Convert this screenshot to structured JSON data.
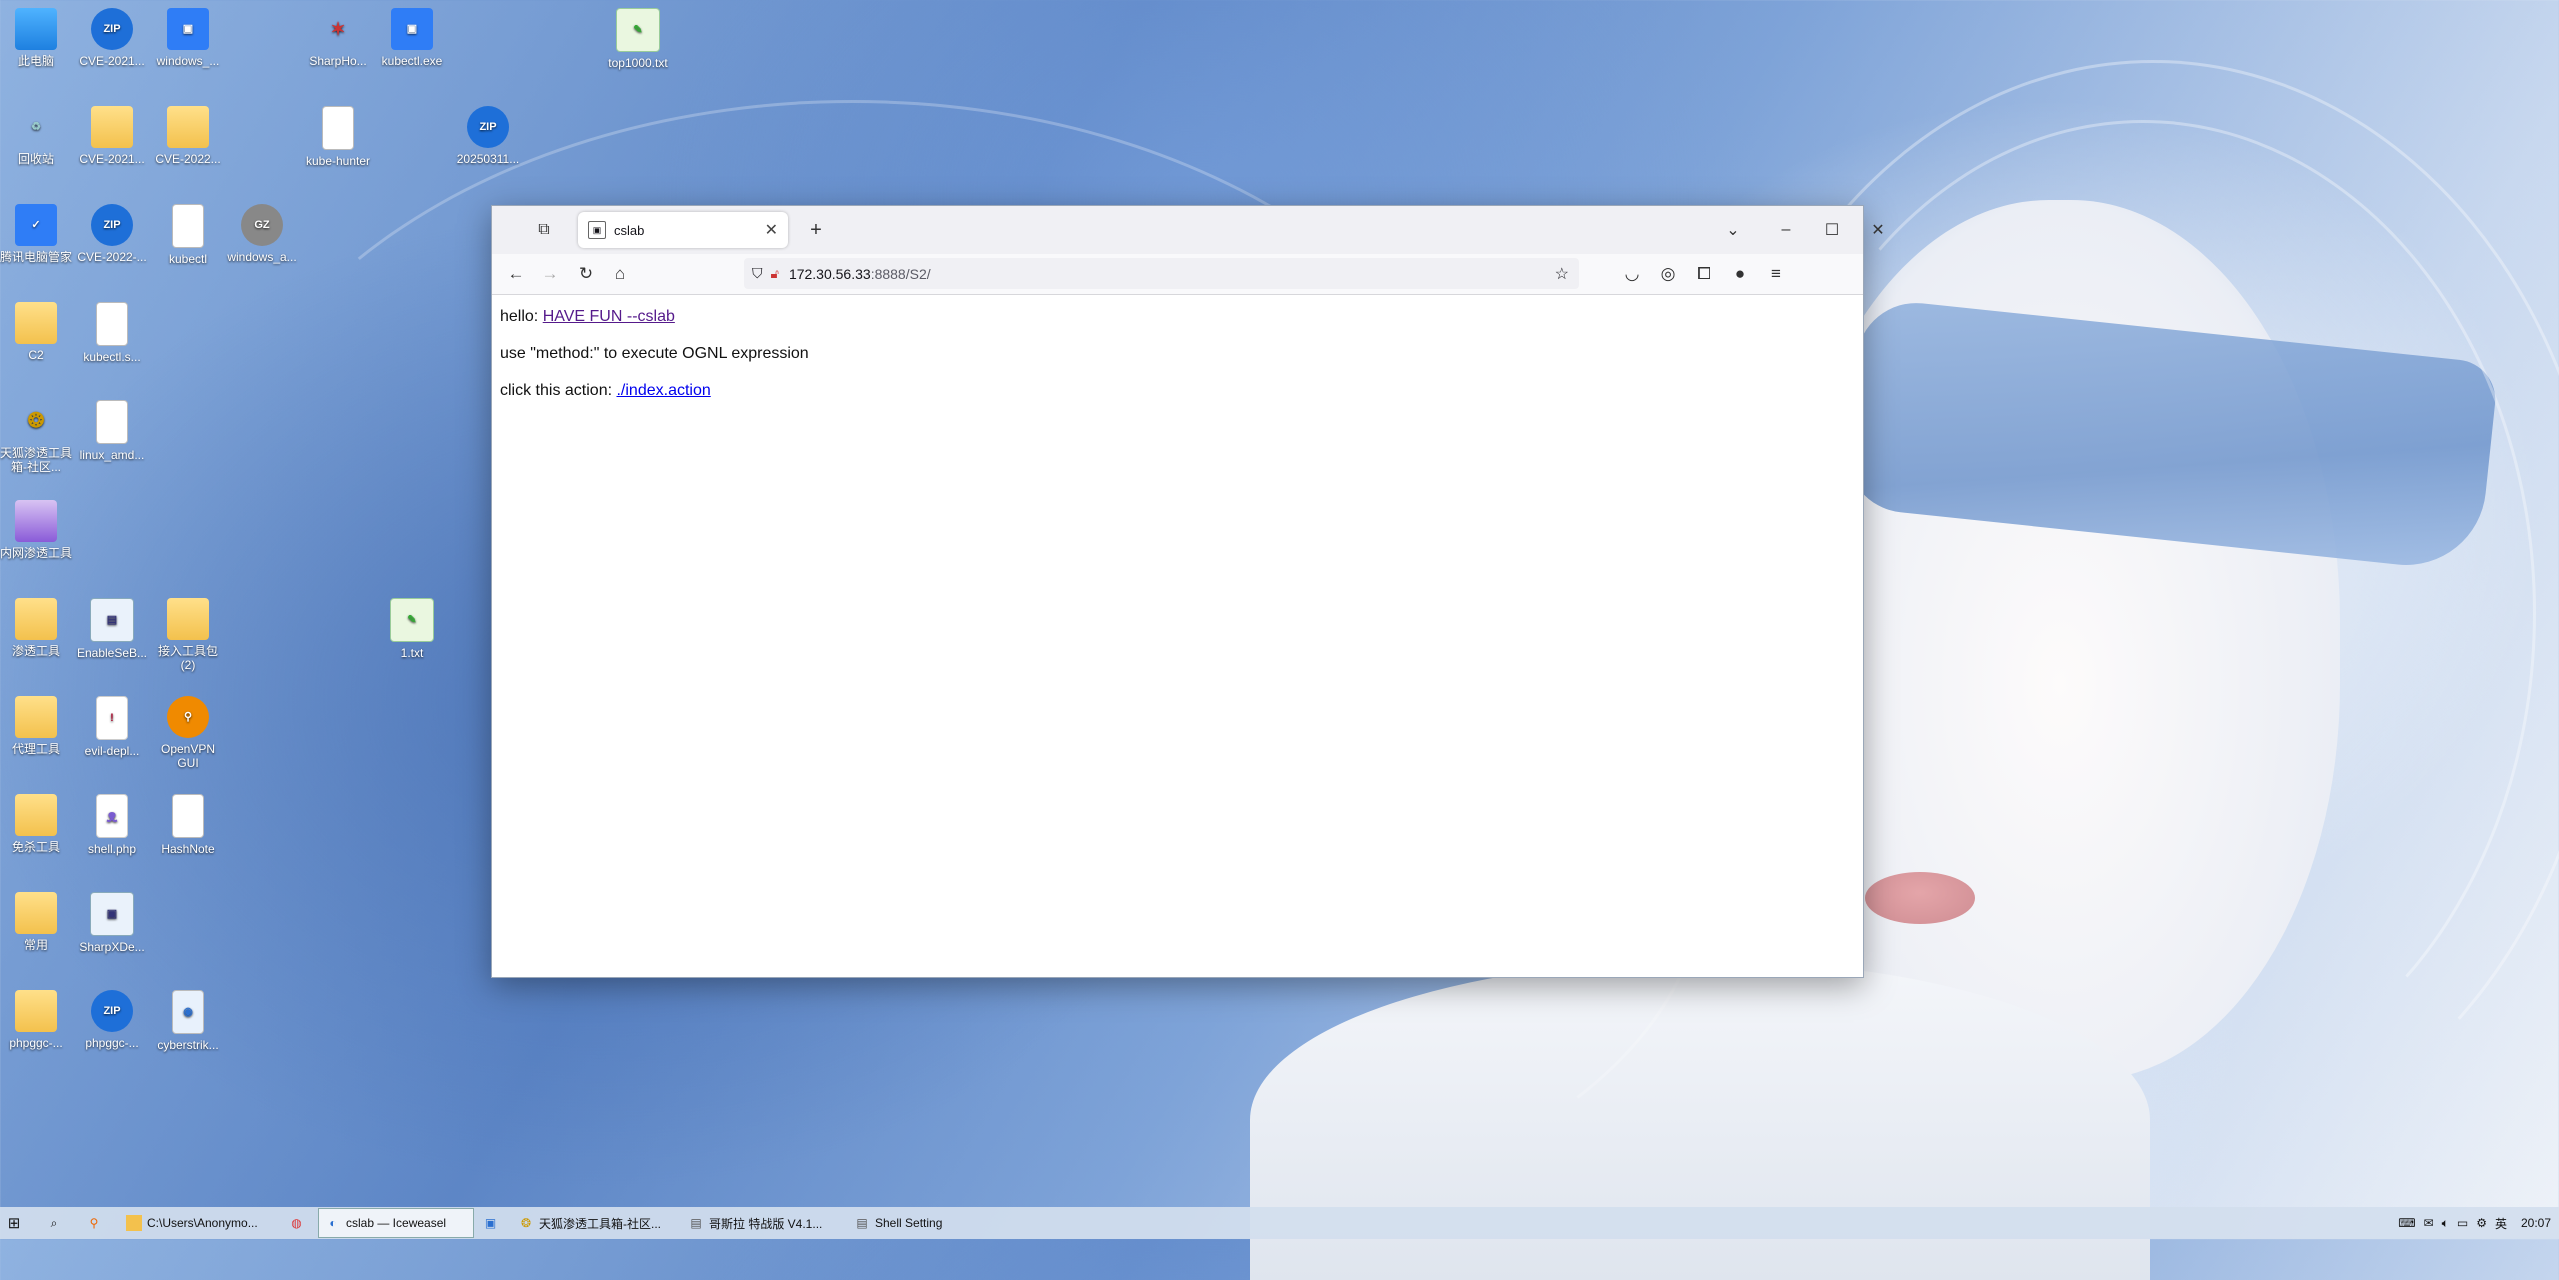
{
  "desktop": {
    "icons": [
      {
        "label": "此电脑",
        "icon": "computer-icon"
      },
      {
        "label": "CVE-2021...",
        "icon": "zip-icon"
      },
      {
        "label": "windows_...",
        "icon": "app-icon"
      },
      {
        "label": "SharpHo...",
        "icon": "app-icon"
      },
      {
        "label": "kubectl.exe",
        "icon": "app-icon"
      },
      {
        "label": "top1000.txt",
        "icon": "text-file-icon"
      },
      {
        "label": "回收站",
        "icon": "recycle-bin-icon"
      },
      {
        "label": "CVE-2021...",
        "icon": "folder-icon"
      },
      {
        "label": "CVE-2022...",
        "icon": "folder-icon"
      },
      {
        "label": "kube-hunter",
        "icon": "file-icon"
      },
      {
        "label": "20250311...",
        "icon": "zip-icon"
      },
      {
        "label": "腾讯电脑管家",
        "icon": "shield-app-icon"
      },
      {
        "label": "CVE-2022-...",
        "icon": "zip-icon"
      },
      {
        "label": "kubectl",
        "icon": "file-icon"
      },
      {
        "label": "windows_a...",
        "icon": "gz-icon"
      },
      {
        "label": "C2",
        "icon": "folder-icon"
      },
      {
        "label": "kubectl.s...",
        "icon": "file-icon"
      },
      {
        "label": "天狐渗透工具箱-社区...",
        "icon": "app-icon"
      },
      {
        "label": "linux_amd...",
        "icon": "file-icon"
      },
      {
        "label": "内网渗透工具",
        "icon": "folder-icon"
      },
      {
        "label": "渗透工具",
        "icon": "folder-icon"
      },
      {
        "label": "EnableSeB...",
        "icon": "image-file-icon"
      },
      {
        "label": "接入工具包(2)",
        "icon": "folder-icon"
      },
      {
        "label": "1.txt",
        "icon": "text-file-icon"
      },
      {
        "label": "代理工具",
        "icon": "folder-icon"
      },
      {
        "label": "evil-depl...",
        "icon": "warning-file-icon"
      },
      {
        "label": "OpenVPN GUI",
        "icon": "openvpn-icon"
      },
      {
        "label": "免杀工具",
        "icon": "folder-icon"
      },
      {
        "label": "shell.php",
        "icon": "php-file-icon"
      },
      {
        "label": "HashNote",
        "icon": "file-icon"
      },
      {
        "label": "常用",
        "icon": "folder-icon"
      },
      {
        "label": "SharpXDe...",
        "icon": "app-icon"
      },
      {
        "label": "phpggc-...",
        "icon": "folder-icon"
      },
      {
        "label": "phpggc-...",
        "icon": "zip-icon"
      },
      {
        "label": "cyberstrik...",
        "icon": "file-icon"
      }
    ]
  },
  "browser": {
    "tab_title": "cslab",
    "url_host": "172.30.56.33",
    "url_rest": ":8888/S2/",
    "content": {
      "line1_prefix": "hello: ",
      "line1_link": "HAVE FUN --cslab",
      "line2": "use \"method:\" to execute OGNL expression",
      "line3_prefix": "click this action: ",
      "line3_link": "./index.action"
    }
  },
  "taskbar": {
    "items": [
      {
        "label": "C:\\Users\\Anonymo...",
        "icon": "folder-icon",
        "active": false
      },
      {
        "label": "",
        "icon": "chrome-icon",
        "active": false
      },
      {
        "label": "cslab — Iceweasel",
        "icon": "browser-icon",
        "active": true
      },
      {
        "label": "",
        "icon": "app-icon",
        "active": false
      },
      {
        "label": "天狐渗透工具箱-社区...",
        "icon": "app-icon",
        "active": false
      },
      {
        "label": "哥斯拉 特战版 V4.1...",
        "icon": "app-icon",
        "active": false
      },
      {
        "label": "Shell Setting",
        "icon": "app-icon",
        "active": false
      }
    ],
    "tray_ime": "英",
    "clock": "20:07"
  }
}
